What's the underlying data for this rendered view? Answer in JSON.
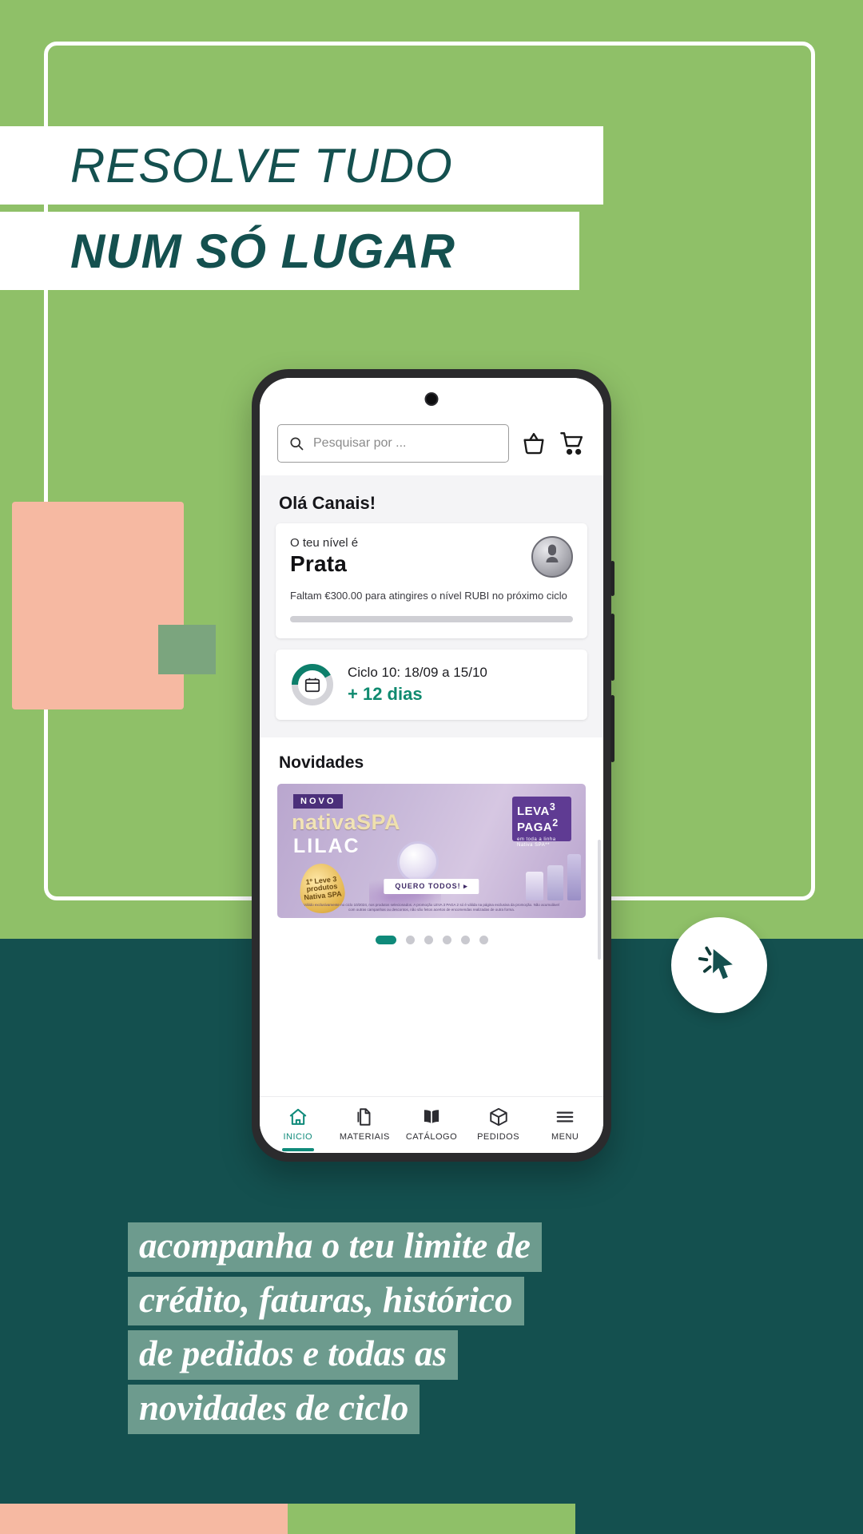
{
  "poster": {
    "headline_line1": "RESOLVE TUDO",
    "headline_line2": "NUM SÓ LUGAR",
    "caption_lines": [
      "acompanha o teu limite de",
      "crédito, faturas, histórico",
      "de pedidos e todas as",
      "novidades de ciclo"
    ],
    "colors": {
      "green": "#8fc068",
      "teal": "#14504f",
      "salmon": "#f6b9a2",
      "sage": "#7ba57e",
      "caption_bg": "#6d9b8e",
      "accent": "#0f8a7a"
    }
  },
  "phone": {
    "header": {
      "search": {
        "placeholder": "Pesquisar por ...",
        "value": "",
        "icon": "search-icon"
      },
      "basket_icon": "basket-icon",
      "cart_icon": "shopping-cart-icon"
    },
    "greeting": "Olá Canais!",
    "level_card": {
      "label": "O teu nível é",
      "level": "Prata",
      "description": "Faltam €300.00 para atingires o nível RUBI no próximo ciclo",
      "medal_icon": "medal-icon",
      "progress_percent": 0
    },
    "cycle_card": {
      "calendar_icon": "calendar-icon",
      "title": "Ciclo 10: 18/09 a 15/10",
      "remaining": "+ 12 dias",
      "ring_percent": 42
    },
    "news": {
      "title": "Novidades",
      "banner": {
        "badge": "NOVO",
        "brand_first": "nativa",
        "brand_second": "SPA",
        "subtitle": "LILAC",
        "drop_text": "1º Leve 3 produtos Nativa SPA",
        "promo_line1": "LEVA",
        "promo_num1": "3",
        "promo_line2": "PAGA",
        "promo_num2": "2",
        "promo_note": "em toda a linha Nativa SPA**",
        "cta": "QUERO TODOS! ▸",
        "legal": "Válido exclusivamente no ciclo 10/2024, nos produtos selecionados. A promoção LEVA 3 PAGA 2 só é válida na página exclusiva da promoção. Não acumulável com outras campanhas ou descontos, não são feitos acertos de encomendas realizadas de outra forma."
      },
      "pagination": {
        "total": 6,
        "active_index": 0
      }
    },
    "bottom_nav": [
      {
        "label": "INICIO",
        "icon": "home-icon",
        "active": true
      },
      {
        "label": "MATERIAIS",
        "icon": "files-icon",
        "active": false
      },
      {
        "label": "CATÁLOGO",
        "icon": "book-icon",
        "active": false
      },
      {
        "label": "PEDIDOS",
        "icon": "package-icon",
        "active": false
      },
      {
        "label": "MENU",
        "icon": "hamburger-icon",
        "active": false
      }
    ]
  },
  "cursor_badge": {
    "icon": "click-cursor-icon"
  }
}
